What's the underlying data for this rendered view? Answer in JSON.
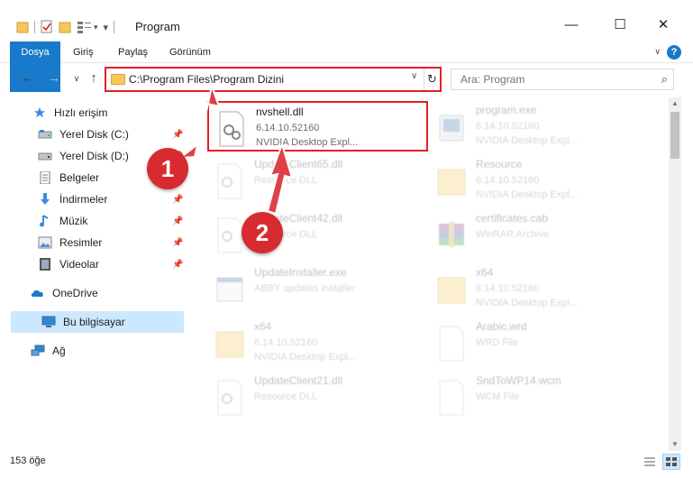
{
  "window": {
    "title": "Program",
    "minimize": "—",
    "maximize": "☐",
    "close": "✕"
  },
  "ribbon": {
    "tabs": [
      {
        "label": "Dosya"
      },
      {
        "label": "Giriş"
      },
      {
        "label": "Paylaş"
      },
      {
        "label": "Görünüm"
      }
    ],
    "help": "?"
  },
  "nav": {
    "address_path": "C:\\Program Files\\Program Dizini",
    "search_placeholder": "Ara: Program"
  },
  "sidebar": {
    "items": [
      {
        "label": "Hızlı erişim",
        "icon": "star-icon"
      },
      {
        "label": "Yerel Disk (C:)",
        "icon": "drive-icon"
      },
      {
        "label": "Yerel Disk (D:)",
        "icon": "drive-icon"
      },
      {
        "label": "Belgeler",
        "icon": "documents-icon"
      },
      {
        "label": "İndirmeler",
        "icon": "download-icon"
      },
      {
        "label": "Müzik",
        "icon": "music-icon"
      },
      {
        "label": "Resimler",
        "icon": "pictures-icon"
      },
      {
        "label": "Videolar",
        "icon": "videos-icon"
      },
      {
        "label": "OneDrive",
        "icon": "cloud-icon"
      },
      {
        "label": "Bu bilgisayar",
        "icon": "computer-icon"
      },
      {
        "label": "Ağ",
        "icon": "network-icon"
      }
    ]
  },
  "files": [
    {
      "name": "nvshell.dll",
      "line2": "6.14.10.52160",
      "line3": "NVIDIA Desktop Expl...",
      "icon": "dll-file-icon"
    },
    {
      "name": "program.exe",
      "line2": "6.14.10.52160",
      "line3": "NVIDIA Desktop Expl...",
      "icon": "exe-file-icon"
    },
    {
      "name": "UpdateClient65.dll",
      "line2": "Resource DLL",
      "line3": "",
      "icon": "dll-file-icon"
    },
    {
      "name": "Resource",
      "line2": "6.14.10.52160",
      "line3": "NVIDIA Desktop Expl...",
      "icon": "folder-file-icon"
    },
    {
      "name": "UpdateClient42.dll",
      "line2": "Resource DLL",
      "line3": "",
      "icon": "dll-file-icon"
    },
    {
      "name": "certificates.cab",
      "line2": "WinRAR Archive",
      "line3": "",
      "icon": "archive-file-icon"
    },
    {
      "name": "UpdateInstaller.exe",
      "line2": "ABBY updates installer",
      "line3": "",
      "icon": "exe-file-icon"
    },
    {
      "name": "x64",
      "line2": "6.14.10.52160",
      "line3": "NVIDIA Desktop Expl...",
      "icon": "folder-file-icon"
    },
    {
      "name": "x64",
      "line2": "6.14.10.52160",
      "line3": "NVIDIA Desktop Expl...",
      "icon": "folder-file-icon"
    },
    {
      "name": "Arabic.wrd",
      "line2": "WRD File",
      "line3": "",
      "icon": "generic-file-icon"
    },
    {
      "name": "UpdateClient21.dll",
      "line2": "Resource DLL",
      "line3": "",
      "icon": "dll-file-icon"
    },
    {
      "name": "SndToWP14.wcm",
      "line2": "WCM File",
      "line3": "",
      "icon": "generic-file-icon"
    }
  ],
  "status": {
    "item_count": "153 öğe"
  },
  "callouts": [
    "1",
    "2"
  ],
  "colors": {
    "accent": "#1979ca",
    "highlight": "#e31f25",
    "callout": "#d72b31",
    "selected": "#cce8ff"
  }
}
